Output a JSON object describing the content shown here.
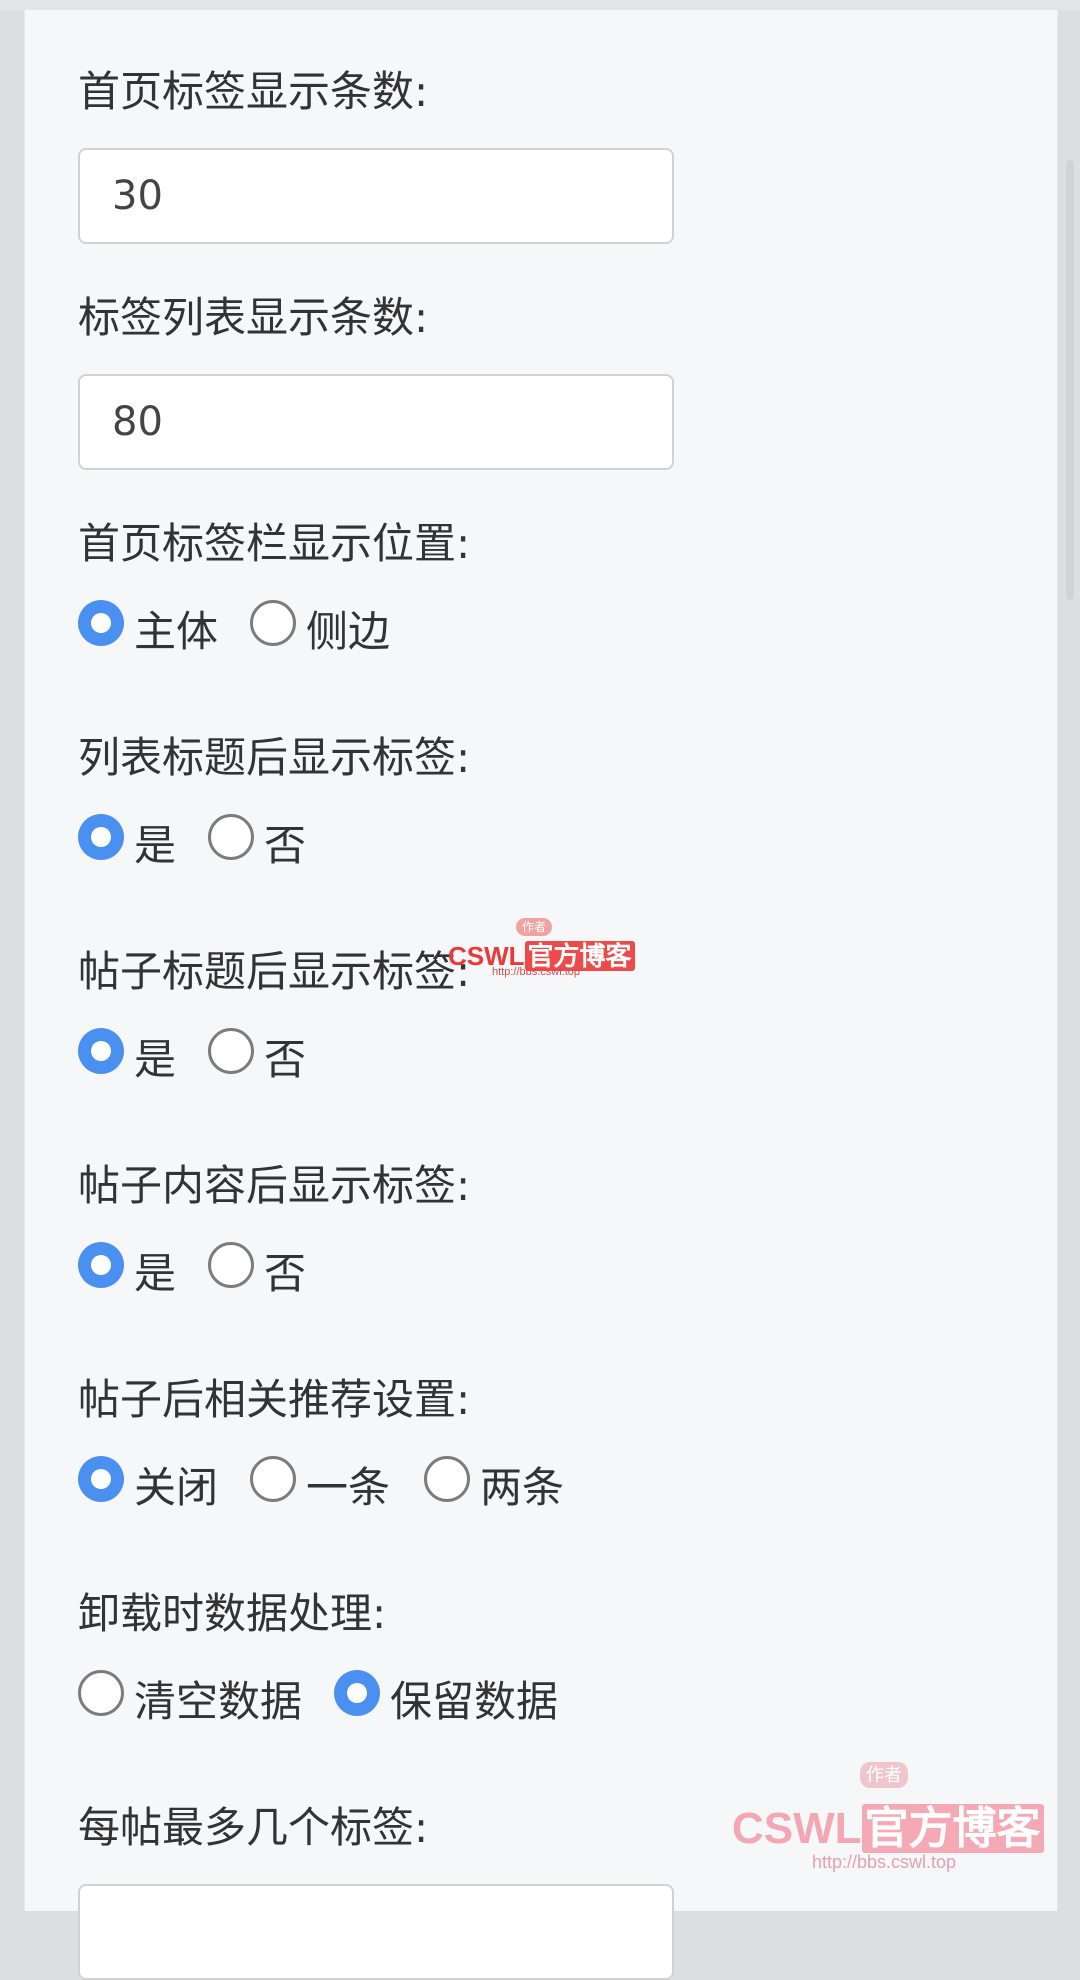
{
  "settings": {
    "home_tag_count": {
      "label": "首页标签显示条数:",
      "value": "30"
    },
    "tag_list_count": {
      "label": "标签列表显示条数:",
      "value": "80"
    },
    "home_tagbar_position": {
      "label": "首页标签栏显示位置:",
      "options": [
        "主体",
        "侧边"
      ],
      "selected": 0
    },
    "list_title_tags": {
      "label": "列表标题后显示标签:",
      "options": [
        "是",
        "否"
      ],
      "selected": 0
    },
    "post_title_tags": {
      "label": "帖子标题后显示标签:",
      "options": [
        "是",
        "否"
      ],
      "selected": 0
    },
    "post_content_tags": {
      "label": "帖子内容后显示标签:",
      "options": [
        "是",
        "否"
      ],
      "selected": 0
    },
    "related_recommend": {
      "label": "帖子后相关推荐设置:",
      "options": [
        "关闭",
        "一条",
        "两条"
      ],
      "selected": 0
    },
    "uninstall_data": {
      "label": "卸载时数据处理:",
      "options": [
        "清空数据",
        "保留数据"
      ],
      "selected": 1
    },
    "max_tags_per_post": {
      "label": "每帖最多几个标签:",
      "value": ""
    }
  },
  "watermark": {
    "badge": "作者",
    "brand_latin": "CSWL",
    "brand_cn": "官方博客",
    "url": "http://bbs.cswl.top"
  },
  "colors": {
    "radio_selected": "#4a90f0",
    "panel_bg": "#f6f7f9",
    "text": "#333333",
    "watermark": "#ee3838"
  }
}
